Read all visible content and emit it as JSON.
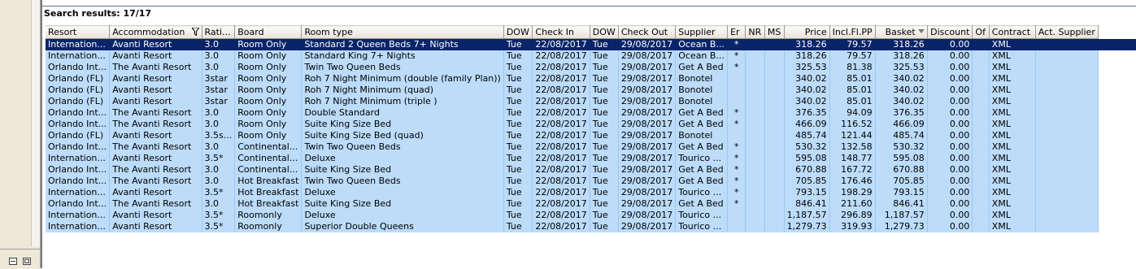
{
  "results_header": "Search results: 17/17",
  "columns": [
    "Resort",
    "Accommodation",
    "Rati...",
    "Board",
    "Room type",
    "DOW",
    "Check In",
    "DOW",
    "Check Out",
    "Supplier",
    "Er",
    "NR",
    "MS",
    "Price",
    "Incl.Fl.PP",
    "Basket",
    "Discount",
    "Of",
    "Contract",
    "Act. Supplier"
  ],
  "rows": [
    [
      "Internation...",
      "Avanti Resort",
      "3.0",
      "Room Only",
      "Standard 2 Queen Beds 7+  Nights",
      "Tue",
      "22/08/2017",
      "Tue",
      "29/08/2017",
      "Ocean B...",
      "*",
      "",
      "",
      "318.26",
      "79.57",
      "318.26",
      "0.00",
      "",
      "XML",
      ""
    ],
    [
      "Internation...",
      "Avanti Resort",
      "3.0",
      "Room Only",
      "Standard King 7+ Nights",
      "Tue",
      "22/08/2017",
      "Tue",
      "29/08/2017",
      "Ocean B...",
      "*",
      "",
      "",
      "318.26",
      "79.57",
      "318.26",
      "0.00",
      "",
      "XML",
      ""
    ],
    [
      "Orlando Int...",
      "The Avanti Resort",
      "3.0",
      "Room Only",
      "Twin Two Queen Beds",
      "Tue",
      "22/08/2017",
      "Tue",
      "29/08/2017",
      "Get A Bed",
      "*",
      "",
      "",
      "325.53",
      "81.38",
      "325.53",
      "0.00",
      "",
      "XML",
      ""
    ],
    [
      "Orlando (FL)",
      "Avanti Resort",
      "3star",
      "Room Only",
      "Roh 7 Night Minimum  (double (family Plan))",
      "Tue",
      "22/08/2017",
      "Tue",
      "29/08/2017",
      "Bonotel",
      "",
      "",
      "",
      "340.02",
      "85.01",
      "340.02",
      "0.00",
      "",
      "XML",
      ""
    ],
    [
      "Orlando (FL)",
      "Avanti Resort",
      "3star",
      "Room Only",
      "Roh 7 Night Minimum  (quad)",
      "Tue",
      "22/08/2017",
      "Tue",
      "29/08/2017",
      "Bonotel",
      "",
      "",
      "",
      "340.02",
      "85.01",
      "340.02",
      "0.00",
      "",
      "XML",
      ""
    ],
    [
      "Orlando (FL)",
      "Avanti Resort",
      "3star",
      "Room Only",
      "Roh 7 Night Minimum  (triple )",
      "Tue",
      "22/08/2017",
      "Tue",
      "29/08/2017",
      "Bonotel",
      "",
      "",
      "",
      "340.02",
      "85.01",
      "340.02",
      "0.00",
      "",
      "XML",
      ""
    ],
    [
      "Orlando Int...",
      "The Avanti Resort",
      "3.0",
      "Room Only",
      "Double Standard",
      "Tue",
      "22/08/2017",
      "Tue",
      "29/08/2017",
      "Get A Bed",
      "*",
      "",
      "",
      "376.35",
      "94.09",
      "376.35",
      "0.00",
      "",
      "XML",
      ""
    ],
    [
      "Orlando Int...",
      "The Avanti Resort",
      "3.0",
      "Room Only",
      "Suite King Size Bed",
      "Tue",
      "22/08/2017",
      "Tue",
      "29/08/2017",
      "Get A Bed",
      "*",
      "",
      "",
      "466.09",
      "116.52",
      "466.09",
      "0.00",
      "",
      "XML",
      ""
    ],
    [
      "Orlando (FL)",
      "Avanti Resort",
      "3.5s...",
      "Room Only",
      "Suite King Size Bed (quad)",
      "Tue",
      "22/08/2017",
      "Tue",
      "29/08/2017",
      "Bonotel",
      "",
      "",
      "",
      "485.74",
      "121.44",
      "485.74",
      "0.00",
      "",
      "XML",
      ""
    ],
    [
      "Orlando Int...",
      "The Avanti Resort",
      "3.0",
      "Continental...",
      "Twin Two Queen Beds",
      "Tue",
      "22/08/2017",
      "Tue",
      "29/08/2017",
      "Get A Bed",
      "*",
      "",
      "",
      "530.32",
      "132.58",
      "530.32",
      "0.00",
      "",
      "XML",
      ""
    ],
    [
      "Internation...",
      "Avanti Resort",
      "3.5*",
      "Continental...",
      "Deluxe",
      "Tue",
      "22/08/2017",
      "Tue",
      "29/08/2017",
      "Tourico ...",
      "*",
      "",
      "",
      "595.08",
      "148.77",
      "595.08",
      "0.00",
      "",
      "XML",
      ""
    ],
    [
      "Orlando Int...",
      "The Avanti Resort",
      "3.0",
      "Continental...",
      "Suite King Size Bed",
      "Tue",
      "22/08/2017",
      "Tue",
      "29/08/2017",
      "Get A Bed",
      "*",
      "",
      "",
      "670.88",
      "167.72",
      "670.88",
      "0.00",
      "",
      "XML",
      ""
    ],
    [
      "Orlando Int...",
      "The Avanti Resort",
      "3.0",
      "Hot Breakfast",
      "Twin Two Queen Beds",
      "Tue",
      "22/08/2017",
      "Tue",
      "29/08/2017",
      "Get A Bed",
      "*",
      "",
      "",
      "705.85",
      "176.46",
      "705.85",
      "0.00",
      "",
      "XML",
      ""
    ],
    [
      "Internation...",
      "Avanti Resort",
      "3.5*",
      "Hot Breakfast",
      "Deluxe",
      "Tue",
      "22/08/2017",
      "Tue",
      "29/08/2017",
      "Tourico ...",
      "*",
      "",
      "",
      "793.15",
      "198.29",
      "793.15",
      "0.00",
      "",
      "XML",
      ""
    ],
    [
      "Orlando Int...",
      "The Avanti Resort",
      "3.0",
      "Hot Breakfast",
      "Suite King Size Bed",
      "Tue",
      "22/08/2017",
      "Tue",
      "29/08/2017",
      "Get A Bed",
      "*",
      "",
      "",
      "846.41",
      "211.60",
      "846.41",
      "0.00",
      "",
      "XML",
      ""
    ],
    [
      "Internation...",
      "Avanti Resort",
      "3.5*",
      "Roomonly",
      "Deluxe",
      "Tue",
      "22/08/2017",
      "Tue",
      "29/08/2017",
      "Tourico ...",
      "",
      "",
      "",
      "1,187.57",
      "296.89",
      "1,187.57",
      "0.00",
      "",
      "XML",
      ""
    ],
    [
      "Internation...",
      "Avanti Resort",
      "3.5*",
      "Roomonly",
      "Superior Double Queens",
      "Tue",
      "22/08/2017",
      "Tue",
      "29/08/2017",
      "Tourico ...",
      "",
      "",
      "",
      "1,279.73",
      "319.93",
      "1,279.73",
      "0.00",
      "",
      "XML",
      ""
    ]
  ],
  "colors": {
    "row_bg": "#bcdcfa",
    "selected_bg": "#0a246a",
    "selected_fg": "#ffffff"
  }
}
